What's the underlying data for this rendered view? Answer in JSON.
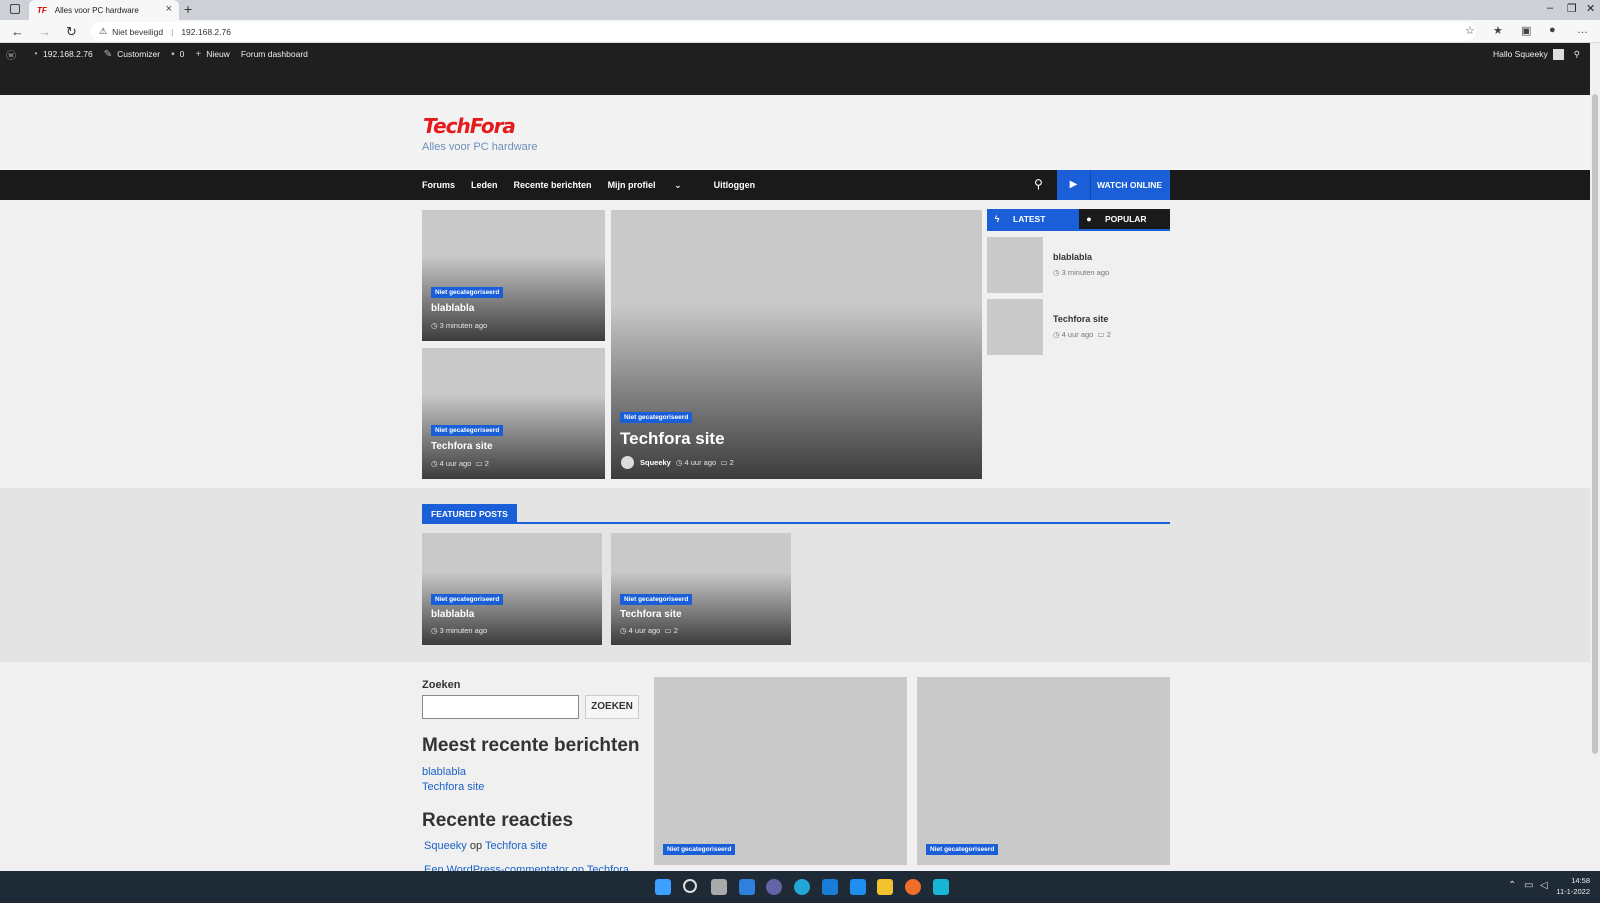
{
  "browser": {
    "tab_title": "Alles voor PC hardware",
    "tab_favicon": "TF",
    "new_tab": "+",
    "security": "Niet beveiligd",
    "url": "192.168.2.76"
  },
  "adminbar": {
    "site": "192.168.2.76",
    "customizer": "Customizer",
    "comments": "0",
    "new": "Nieuw",
    "forum": "Forum dashboard",
    "greeting": "Hallo Squeeky"
  },
  "header": {
    "logo": "TechFora",
    "tagline": "Alles voor PC hardware"
  },
  "nav": {
    "items": [
      "Forums",
      "Leden",
      "Recente berichten",
      "Mijn profiel",
      "Uitloggen"
    ],
    "dropdown_glyph": "⌄",
    "watch_label": "WATCH ONLINE"
  },
  "grid": {
    "small_top": {
      "category": "Niet gecategoriseerd",
      "title": "blablabla",
      "time": "3 minuten ago"
    },
    "small_bottom": {
      "category": "Niet gecategoriseerd",
      "title": "Techfora site",
      "time": "4 uur ago",
      "comments": "2"
    },
    "big": {
      "category": "Niet gecategoriseerd",
      "title": "Techfora site",
      "author": "Squeeky",
      "time": "4 uur ago",
      "comments": "2"
    }
  },
  "sidebar_tabs": {
    "latest": "LATEST",
    "popular": "POPULAR",
    "items": [
      {
        "title": "blablabla",
        "time": "3 minuten ago",
        "comments": ""
      },
      {
        "title": "Techfora site",
        "time": "4 uur ago",
        "comments": "2"
      }
    ]
  },
  "featured": {
    "label": "FEATURED POSTS",
    "posts": [
      {
        "category": "Niet gecategoriseerd",
        "title": "blablabla",
        "time": "3 minuten ago",
        "comments": ""
      },
      {
        "category": "Niet gecategoriseerd",
        "title": "Techfora site",
        "time": "4 uur ago",
        "comments": "2"
      }
    ]
  },
  "widgets": {
    "search_label": "Zoeken",
    "search_button": "ZOEKEN",
    "recent_posts_title": "Meest recente berichten",
    "recent_posts": [
      "blablabla",
      "Techfora site"
    ],
    "recent_comments_title": "Recente reacties",
    "comment_author": "Squeeky",
    "comment_on": "op",
    "comment_post": "Techfora site",
    "cut_off_line": "Een WordPress-commentator op Techfora"
  },
  "lower_cards": [
    {
      "category": "Niet gecategoriseerd"
    },
    {
      "category": "Niet gecategoriseerd"
    }
  ],
  "taskbar": {
    "time": "14:58",
    "date": "11-1-2022"
  },
  "colors": {
    "accent": "#1a5fd8",
    "logo": "#e51b1b",
    "dark": "#1a1a1a"
  }
}
